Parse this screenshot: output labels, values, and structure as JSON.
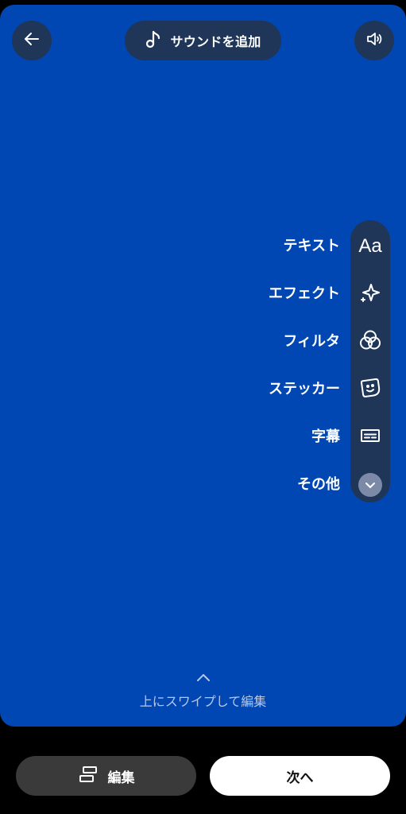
{
  "header": {
    "back_icon": "arrow-left-icon",
    "sound_icon": "music-note-icon",
    "sound_label": "サウンドを追加",
    "volume_icon": "speaker-icon"
  },
  "tools": {
    "items": [
      {
        "label": "テキスト",
        "icon": "text-aa-icon",
        "icon_text": "Aa"
      },
      {
        "label": "エフェクト",
        "icon": "sparkle-icon"
      },
      {
        "label": "フィルタ",
        "icon": "filter-circles-icon"
      },
      {
        "label": "ステッカー",
        "icon": "sticker-icon"
      },
      {
        "label": "字幕",
        "icon": "captions-icon"
      },
      {
        "label": "その他",
        "icon": "chevron-down-icon"
      }
    ]
  },
  "swipe_hint": {
    "icon": "chevron-up-icon",
    "text": "上にスワイプして編集"
  },
  "footer": {
    "edit_label": "編集",
    "edit_icon": "edit-layout-icon",
    "next_label": "次へ"
  },
  "colors": {
    "canvas_background": "#0047b3",
    "control_background": "#1f3658",
    "page_background": "#000000",
    "edit_button_background": "#3a3a3a",
    "next_button_background": "#ffffff"
  }
}
